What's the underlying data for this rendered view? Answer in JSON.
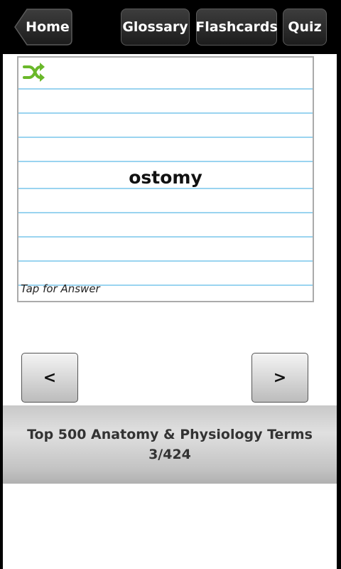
{
  "toolbar": {
    "home_label": "Home",
    "glossary_label": "Glossary",
    "flashcards_label": "Flashcards",
    "quiz_label": "Quiz"
  },
  "card": {
    "term": "ostomy",
    "hint": "Tap for Answer",
    "shuffle_icon": "shuffle-icon",
    "shuffle_color": "#6ab82a"
  },
  "navigation": {
    "prev_label": "<",
    "next_label": ">"
  },
  "footer": {
    "deck_title": "Top 500 Anatomy & Physiology Terms",
    "progress": "3/424"
  }
}
